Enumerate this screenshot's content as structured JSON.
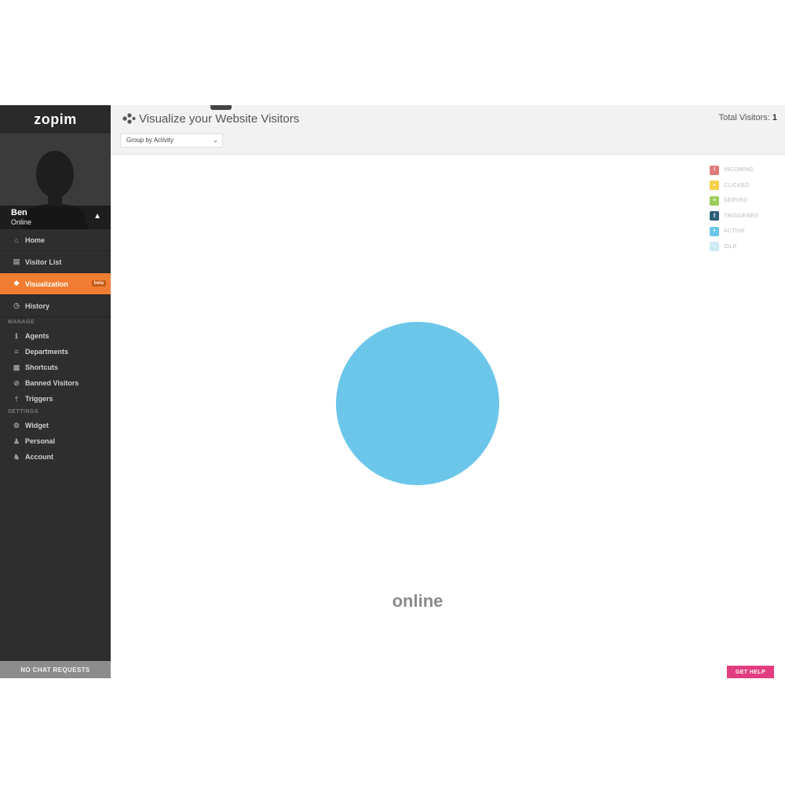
{
  "brand": {
    "name": "zopim"
  },
  "profile": {
    "name": "Ben",
    "status": "Online"
  },
  "nav": {
    "items": [
      {
        "label": "Home",
        "icon": "home-icon"
      },
      {
        "label": "Visitor List",
        "icon": "list-icon"
      },
      {
        "label": "Visualization",
        "icon": "visualization-icon",
        "tag": "beta",
        "active": true
      },
      {
        "label": "History",
        "icon": "clock-icon"
      }
    ],
    "manage": {
      "header": "MANAGE",
      "items": [
        {
          "label": "Agents",
          "icon": "agent-icon"
        },
        {
          "label": "Departments",
          "icon": "departments-icon"
        },
        {
          "label": "Shortcuts",
          "icon": "shortcuts-icon"
        },
        {
          "label": "Banned Visitors",
          "icon": "banned-icon"
        },
        {
          "label": "Triggers",
          "icon": "triggers-icon"
        }
      ]
    },
    "settings": {
      "header": "SETTINGS",
      "items": [
        {
          "label": "Widget",
          "icon": "widget-icon"
        },
        {
          "label": "Personal",
          "icon": "personal-icon"
        },
        {
          "label": "Account",
          "icon": "account-icon"
        }
      ]
    }
  },
  "chat_requests": "NO CHAT REQUESTS",
  "header": {
    "title": "Visualize your Website Visitors",
    "group_by": "Group by Activity",
    "total_label": "Total Visitors:",
    "total_value": "1"
  },
  "legend": [
    {
      "label": "INCOMING",
      "color": "#e07a7a"
    },
    {
      "label": "CLICKED",
      "color": "#f5d24a"
    },
    {
      "label": "SERVED",
      "color": "#9ccc5a"
    },
    {
      "label": "TRIGGERED",
      "color": "#2b5f7a"
    },
    {
      "label": "ACTIVE",
      "color": "#6bc6ea"
    },
    {
      "label": "IDLE",
      "color": "#cfe9f5"
    }
  ],
  "visualization": {
    "group_label": "online",
    "bubble_color": "#6bc6ea",
    "bubble_count": 1
  },
  "help": {
    "label": "GET HELP"
  },
  "colors": {
    "accent": "#f07d32",
    "sidebar": "#2e2e2e",
    "help": "#e23d7e"
  }
}
